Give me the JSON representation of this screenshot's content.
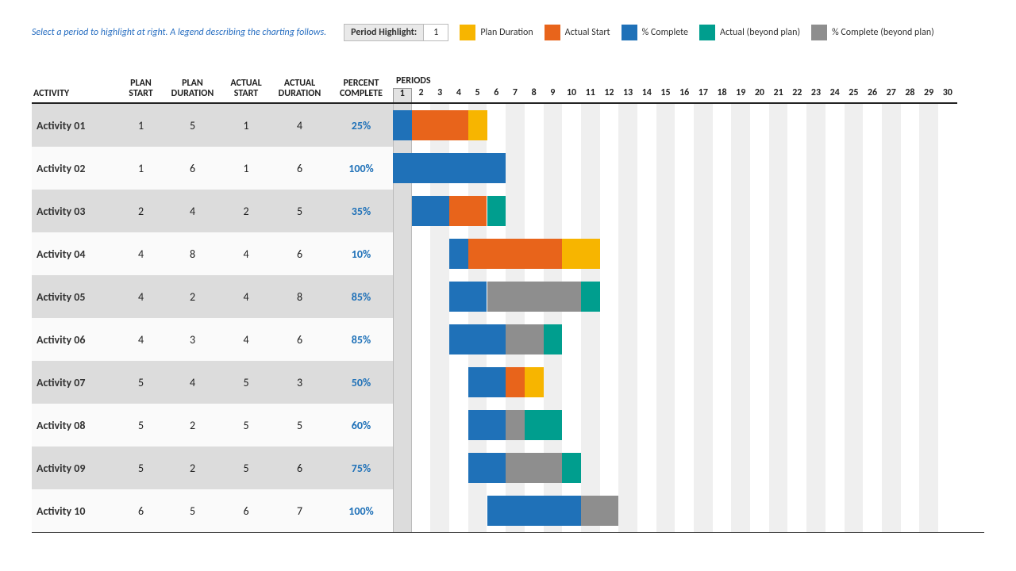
{
  "hint": "Select a period to highlight at right.  A legend describing the charting follows.",
  "period_highlight_label": "Period Highlight:",
  "period_highlight_value": "1",
  "legend": {
    "plan": "Plan Duration",
    "actual": "Actual Start",
    "complete": "% Complete",
    "beyond": "Actual (beyond plan)",
    "cbeyond": "% Complete (beyond plan)"
  },
  "columns": {
    "activity": "ACTIVITY",
    "plan_start": "PLAN START",
    "plan_duration": "PLAN DURATION",
    "actual_start": "ACTUAL START",
    "actual_duration": "ACTUAL DURATION",
    "percent_complete": "PERCENT COMPLETE",
    "periods": "PERIODS"
  },
  "num_periods": 30,
  "highlight_period": 1,
  "colors": {
    "plan": "#f7b500",
    "actual": "#e8641b",
    "complete": "#1f71b8",
    "beyond": "#009e8e",
    "cbeyond": "#8e8e8e"
  },
  "chart_data": {
    "type": "table",
    "title": "Project Planner Gantt",
    "periods": 30,
    "highlight_period": 1,
    "activities": [
      {
        "name": "Activity 01",
        "plan_start": 1,
        "plan_duration": 5,
        "actual_start": 1,
        "actual_duration": 4,
        "percent_complete": 25
      },
      {
        "name": "Activity 02",
        "plan_start": 1,
        "plan_duration": 6,
        "actual_start": 1,
        "actual_duration": 6,
        "percent_complete": 100
      },
      {
        "name": "Activity 03",
        "plan_start": 2,
        "plan_duration": 4,
        "actual_start": 2,
        "actual_duration": 5,
        "percent_complete": 35
      },
      {
        "name": "Activity 04",
        "plan_start": 4,
        "plan_duration": 8,
        "actual_start": 4,
        "actual_duration": 6,
        "percent_complete": 10
      },
      {
        "name": "Activity 05",
        "plan_start": 4,
        "plan_duration": 2,
        "actual_start": 4,
        "actual_duration": 8,
        "percent_complete": 85
      },
      {
        "name": "Activity 06",
        "plan_start": 4,
        "plan_duration": 3,
        "actual_start": 4,
        "actual_duration": 6,
        "percent_complete": 85
      },
      {
        "name": "Activity 07",
        "plan_start": 5,
        "plan_duration": 4,
        "actual_start": 5,
        "actual_duration": 3,
        "percent_complete": 50
      },
      {
        "name": "Activity 08",
        "plan_start": 5,
        "plan_duration": 2,
        "actual_start": 5,
        "actual_duration": 5,
        "percent_complete": 60
      },
      {
        "name": "Activity 09",
        "plan_start": 5,
        "plan_duration": 2,
        "actual_start": 5,
        "actual_duration": 6,
        "percent_complete": 75
      },
      {
        "name": "Activity 10",
        "plan_start": 6,
        "plan_duration": 5,
        "actual_start": 6,
        "actual_duration": 7,
        "percent_complete": 100
      }
    ]
  }
}
